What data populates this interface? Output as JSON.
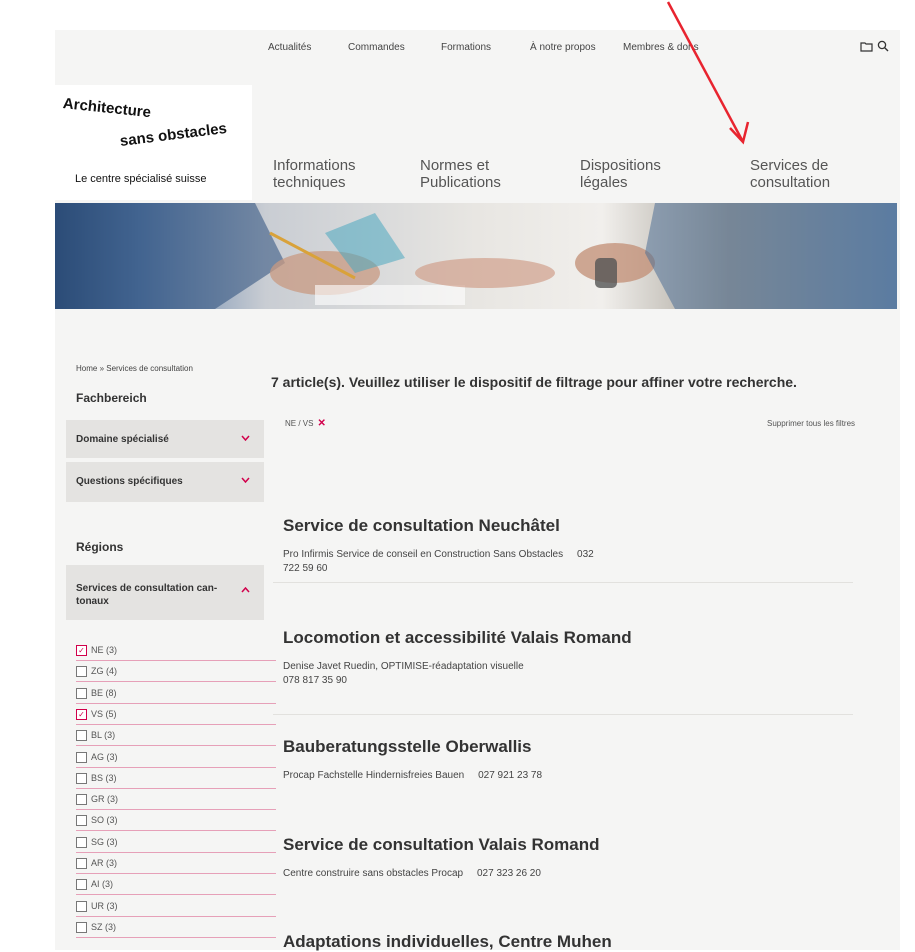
{
  "top_nav": [
    "Actualités",
    "Commandes",
    "Formations",
    "À notre propos",
    "Membres & dons"
  ],
  "top_icons": {
    "folder": "folder-icon",
    "search": "search-icon"
  },
  "logo": {
    "line1": "Architecture",
    "line2": "sans obstacles",
    "tagline": "Le centre spécialisé suisse"
  },
  "main_nav": [
    {
      "line1": "Informations",
      "line2": "techniques"
    },
    {
      "line1": "Normes et",
      "line2": "Publications"
    },
    {
      "line1": "Dispositions",
      "line2": "légales"
    },
    {
      "line1": "Services de",
      "line2": "consultation"
    }
  ],
  "breadcrumb": "Home » Services de consultation",
  "sidebar": {
    "fachbereich": "Fachbereich",
    "domaine": "Domaine spécialisé",
    "questions": "Questions spécifiques",
    "regions": "Régions",
    "services_line1": "Services de consultation can-",
    "services_line2": "tonaux",
    "checkboxes": [
      {
        "label": "NE (3)",
        "checked": true
      },
      {
        "label": "ZG (4)",
        "checked": false
      },
      {
        "label": "BE (8)",
        "checked": false
      },
      {
        "label": "VS (5)",
        "checked": true
      },
      {
        "label": "BL (3)",
        "checked": false
      },
      {
        "label": "AG (3)",
        "checked": false
      },
      {
        "label": "BS (3)",
        "checked": false
      },
      {
        "label": "GR (3)",
        "checked": false
      },
      {
        "label": "SO (3)",
        "checked": false
      },
      {
        "label": "SG (3)",
        "checked": false
      },
      {
        "label": "AR (3)",
        "checked": false
      },
      {
        "label": "AI (3)",
        "checked": false
      },
      {
        "label": "UR (3)",
        "checked": false
      },
      {
        "label": "SZ (3)",
        "checked": false
      }
    ]
  },
  "main": {
    "count_title": "7 article(s). Veuillez utiliser le dispositif de filtrage pour affiner votre recherche.",
    "filter_tag": "NE / VS",
    "filter_remove": "✕",
    "clear_all": "Supprimer tous les filtres",
    "results": [
      {
        "title": "Service de consultation Neuchâtel",
        "line1": "Pro Infirmis Service de conseil en Construction Sans Obstacles     032",
        "line2": "722 59 60"
      },
      {
        "title": "Locomotion et accessibilité Valais Romand",
        "line1": "Denise Javet Ruedin, OPTIMISE-réadaptation visuelle",
        "line2": "078 817 35 90"
      },
      {
        "title": "Bauberatungsstelle Oberwallis",
        "line1": "Procap Fachstelle Hindernisfreies Bauen     027 921 23 78",
        "line2": ""
      },
      {
        "title": "Service de consultation Valais Romand",
        "line1": "Centre construire sans obstacles Procap     027 323 26 20",
        "line2": ""
      },
      {
        "title": "Adaptations individuelles, Centre Muhen",
        "line1": "",
        "line2": ""
      }
    ]
  },
  "colors": {
    "accent": "#d1004b",
    "arrow": "#e8242f",
    "panel": "#f5f5f4",
    "sidebar_item": "#e4e3e1"
  }
}
